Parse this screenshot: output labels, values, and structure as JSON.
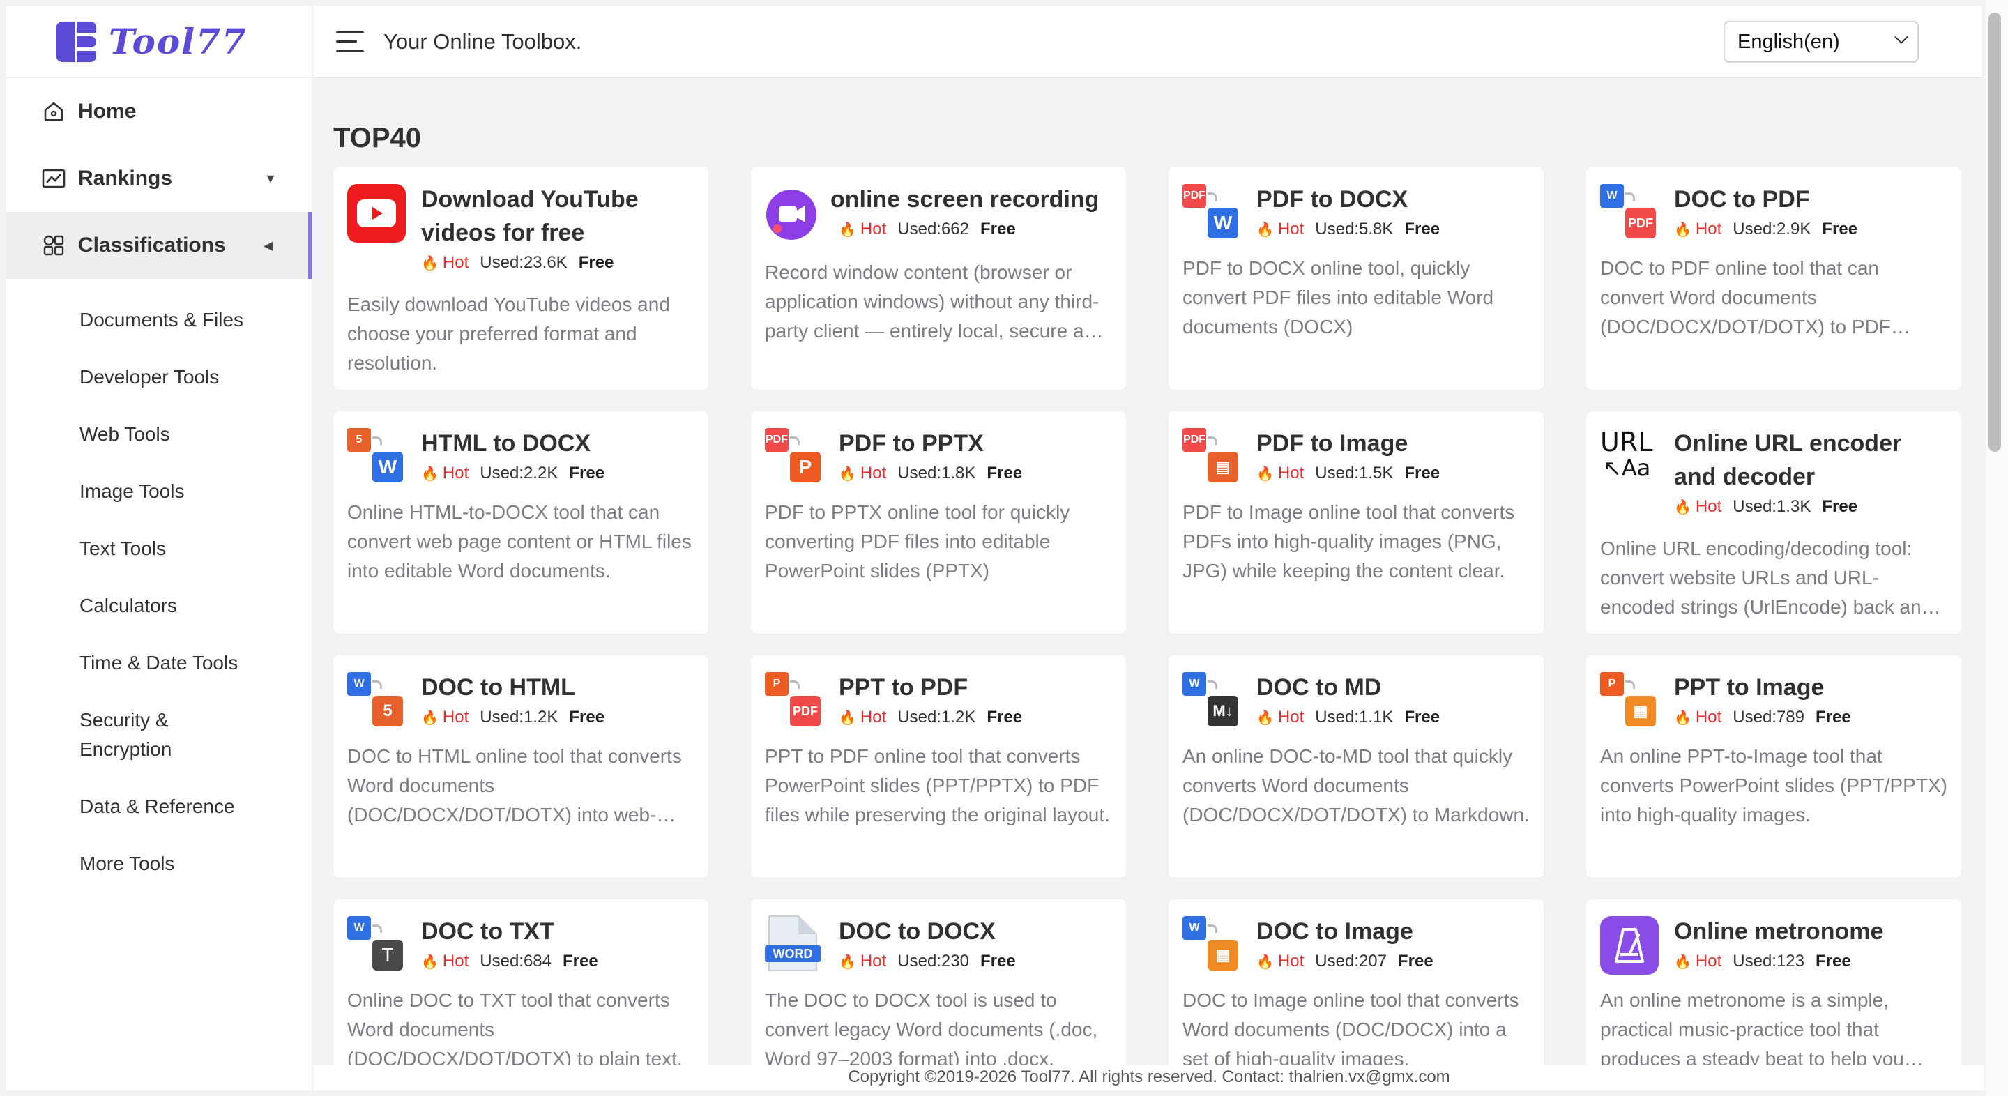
{
  "brand": {
    "logo_text": "Tool77"
  },
  "header": {
    "slogan": "Your Online Toolbox.",
    "language": "English(en)"
  },
  "nav": {
    "home": "Home",
    "rankings": "Rankings",
    "classifications": "Classifications",
    "sub_items": [
      "Documents & Files",
      "Developer Tools",
      "Web Tools",
      "Image Tools",
      "Text Tools",
      "Calculators",
      "Time & Date Tools",
      "Security & Encryption",
      "Data & Reference",
      "More Tools"
    ]
  },
  "section": {
    "title": "TOP40"
  },
  "labels": {
    "hot": "Hot",
    "free": "Free"
  },
  "cards": [
    {
      "title": "Download YouTube videos for free",
      "used": "Used:23.6K",
      "icon": "youtube-icon",
      "desc": "Easily download YouTube videos and choose your preferred format and resolution."
    },
    {
      "title": "online screen recording",
      "used": "Used:662",
      "icon": "screen-record-icon",
      "desc": "Record window content (browser or application windows) without any third-party client — entirely local, secure and private."
    },
    {
      "title": "PDF to DOCX",
      "used": "Used:5.8K",
      "icon": "pdf-to-word-icon",
      "desc": "PDF to DOCX online tool, quickly convert PDF files into editable Word documents (DOCX)"
    },
    {
      "title": "DOC to PDF",
      "used": "Used:2.9K",
      "icon": "word-to-pdf-icon",
      "desc": "DOC to PDF online tool that can convert Word documents (DOC/DOCX/DOT/DOTX) to PDF format."
    },
    {
      "title": "HTML to DOCX",
      "used": "Used:2.2K",
      "icon": "html-to-word-icon",
      "desc": "Online HTML-to-DOCX tool that can convert web page content or HTML files into editable Word documents."
    },
    {
      "title": "PDF to PPTX",
      "used": "Used:1.8K",
      "icon": "pdf-to-ppt-icon",
      "desc": "PDF to PPTX online tool for quickly converting PDF files into editable PowerPoint slides (PPTX)"
    },
    {
      "title": "PDF to Image",
      "used": "Used:1.5K",
      "icon": "pdf-to-image-icon",
      "desc": "PDF to Image online tool that converts PDFs into high-quality images (PNG, JPG) while keeping the content clear."
    },
    {
      "title": "Online URL encoder and decoder",
      "used": "Used:1.3K",
      "icon": "url-encode-icon",
      "desc": "Online URL encoding/decoding tool: convert website URLs and URL-encoded strings (UrlEncode) back and forth."
    },
    {
      "title": "DOC to HTML",
      "used": "Used:1.2K",
      "icon": "word-to-html-icon",
      "desc": "DOC to HTML online tool that converts Word documents (DOC/DOCX/DOT/DOTX) into web-ready HTML."
    },
    {
      "title": "PPT to PDF",
      "used": "Used:1.2K",
      "icon": "ppt-to-pdf-icon",
      "desc": "PPT to PDF online tool that converts PowerPoint slides (PPT/PPTX) to PDF files while preserving the original layout."
    },
    {
      "title": "DOC to MD",
      "used": "Used:1.1K",
      "icon": "word-to-md-icon",
      "desc": "An online DOC-to-MD tool that quickly converts Word documents (DOC/DOCX/DOT/DOTX) to Markdown."
    },
    {
      "title": "PPT to Image",
      "used": "Used:789",
      "icon": "ppt-to-image-icon",
      "desc": "An online PPT-to-Image tool that converts PowerPoint slides (PPT/PPTX) into high-quality images."
    },
    {
      "title": "DOC to TXT",
      "used": "Used:684",
      "icon": "word-to-txt-icon",
      "desc": "Online DOC to TXT tool that converts Word documents (DOC/DOCX/DOT/DOTX) to plain text."
    },
    {
      "title": "DOC to DOCX",
      "used": "Used:230",
      "icon": "word-file-icon",
      "desc": "The DOC to DOCX tool is used to convert legacy Word documents (.doc, Word 97–2003 format) into .docx."
    },
    {
      "title": "DOC to Image",
      "used": "Used:207",
      "icon": "word-to-image-icon",
      "desc": "DOC to Image online tool that converts Word documents (DOC/DOCX) into a set of high-quality images."
    },
    {
      "title": "Online metronome",
      "used": "Used:123",
      "icon": "metronome-icon",
      "desc": "An online metronome is a simple, practical music-practice tool that produces a steady beat to help you keep time."
    }
  ],
  "footer": {
    "text": "Copyright ©2019-2026 Tool77. All rights reserved. Contact: thalrien.vx@gmx.com"
  }
}
